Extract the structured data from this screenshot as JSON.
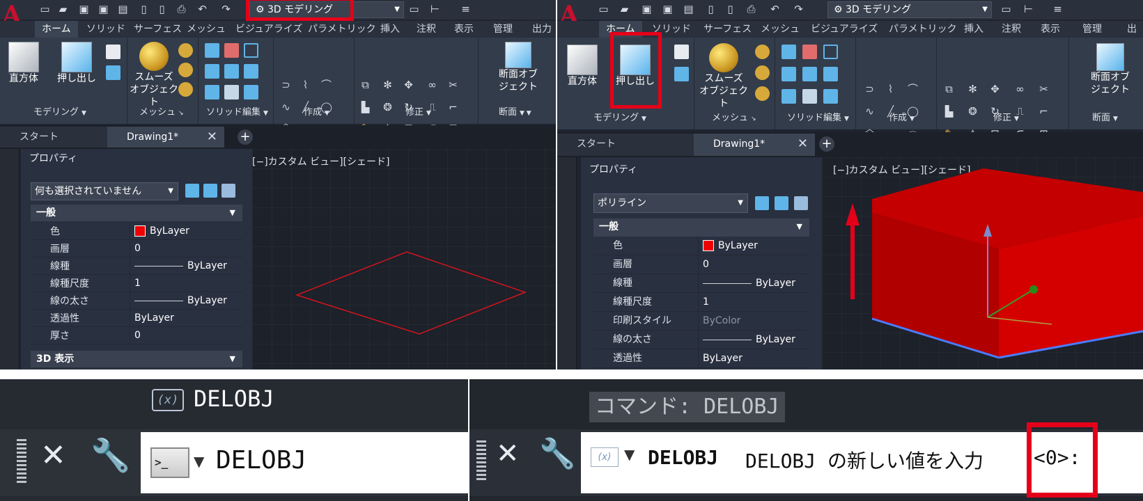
{
  "workspace": {
    "label": "3D モデリング"
  },
  "ribbon_tabs": [
    "ホーム",
    "ソリッド",
    "サーフェス",
    "メッシュ",
    "ビジュアライズ",
    "パラメトリック",
    "挿入",
    "注釈",
    "表示",
    "管理",
    "出力"
  ],
  "ribbon": {
    "box_label": "直方体",
    "extrude_label": "押し出し",
    "smooth_label_1": "スムーズ",
    "smooth_label_2": "オブジェクト",
    "section_label_1": "断面オブ",
    "section_label_2": "ジェクト",
    "groups": {
      "modeling": "モデリング",
      "mesh": "メッシュ",
      "solid_edit": "ソリッド編集",
      "draw": "作成",
      "modify": "修正",
      "section": "断面"
    }
  },
  "doc_tabs": {
    "start": "スタート",
    "drawing": "Drawing1*",
    "plus": "+"
  },
  "viewport_label": "[−]カスタム ビュー][シェード]",
  "properties_left": {
    "title": "プロパティ",
    "selection": "何も選択されていません",
    "section_general": "一般",
    "section_3d": "3D 表示",
    "rows": [
      {
        "name": "色",
        "value": "ByLayer"
      },
      {
        "name": "画層",
        "value": "0"
      },
      {
        "name": "線種",
        "value": "ByLayer"
      },
      {
        "name": "線種尺度",
        "value": "1"
      },
      {
        "name": "線の太さ",
        "value": "ByLayer"
      },
      {
        "name": "透過性",
        "value": "ByLayer"
      },
      {
        "name": "厚さ",
        "value": "0"
      }
    ]
  },
  "properties_right": {
    "title": "プロパティ",
    "selection": "ポリライン",
    "section_general": "一般",
    "rows": [
      {
        "name": "色",
        "value": "ByLayer"
      },
      {
        "name": "画層",
        "value": "0"
      },
      {
        "name": "線種",
        "value": "ByLayer"
      },
      {
        "name": "線種尺度",
        "value": "1"
      },
      {
        "name": "印刷スタイル",
        "value": "ByColor"
      },
      {
        "name": "線の太さ",
        "value": "ByLayer"
      },
      {
        "name": "透過性",
        "value": "ByLayer"
      }
    ]
  },
  "command_left": {
    "suggestion": "DELOBJ",
    "input": "DELOBJ"
  },
  "command_right": {
    "history": "コマンド: DELOBJ",
    "command": "DELOBJ",
    "prompt": "DELOBJ の新しい値を入力",
    "default": "<0>:"
  },
  "colors": {
    "accent_red": "#e5001a",
    "dark_bg": "#1f2430",
    "ribbon": "#333c4a",
    "solid_red": "#cc0000"
  }
}
